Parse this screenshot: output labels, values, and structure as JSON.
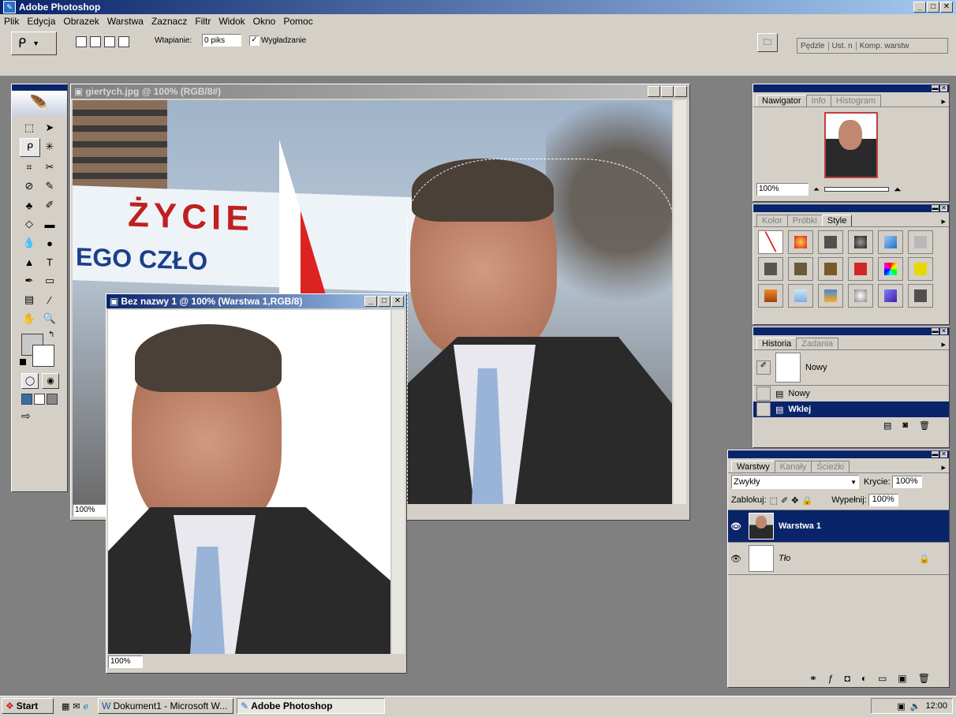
{
  "app": {
    "title": "Adobe Photoshop"
  },
  "menu": [
    "Plik",
    "Edycja",
    "Obrazek",
    "Warstwa",
    "Zaznacz",
    "Filtr",
    "Widok",
    "Okno",
    "Pomoc"
  ],
  "options": {
    "feather_label": "Wtapianie:",
    "feather_value": "0 piks",
    "antialias_label": "Wygładzanie",
    "antialias_checked": true,
    "palette_tabs": [
      "Pędzle",
      "Ust. n",
      "Komp. warstw"
    ]
  },
  "documents": {
    "doc1": {
      "title": "giertych.jpg @ 100% (RGB/8#)",
      "zoom": "100%",
      "banner_text1": "ŻYCIE",
      "banner_text2": "EGO CZŁO"
    },
    "doc2": {
      "title": "Bez nazwy 1 @ 100% (Warstwa 1,RGB/8)",
      "zoom": "100%"
    }
  },
  "navigator": {
    "tabs": [
      "Nawigator",
      "Info",
      "Histogram"
    ],
    "zoom": "100%"
  },
  "color_panel": {
    "tabs": [
      "Kolor",
      "Próbki",
      "Style"
    ]
  },
  "history": {
    "tabs": [
      "Historia",
      "Zadania"
    ],
    "snapshot": "Nowy",
    "items": [
      {
        "label": "Nowy",
        "selected": false
      },
      {
        "label": "Wklej",
        "selected": true
      }
    ]
  },
  "layers": {
    "tabs": [
      "Warstwy",
      "Kanały",
      "Ścieżki"
    ],
    "blend_mode": "Zwykły",
    "opacity_label": "Krycie:",
    "opacity": "100%",
    "lock_label": "Zablokuj:",
    "fill_label": "Wypełnij:",
    "fill": "100%",
    "items": [
      {
        "name": "Warstwa 1",
        "selected": true
      },
      {
        "name": "Tło",
        "selected": false
      }
    ]
  },
  "taskbar": {
    "start": "Start",
    "tasks": [
      "Dokument1 - Microsoft W...",
      "Adobe Photoshop"
    ],
    "clock": "12:00"
  },
  "colors": {
    "titlebar": "#0a246a",
    "face": "#d4d0c8",
    "workspace": "#808080"
  }
}
